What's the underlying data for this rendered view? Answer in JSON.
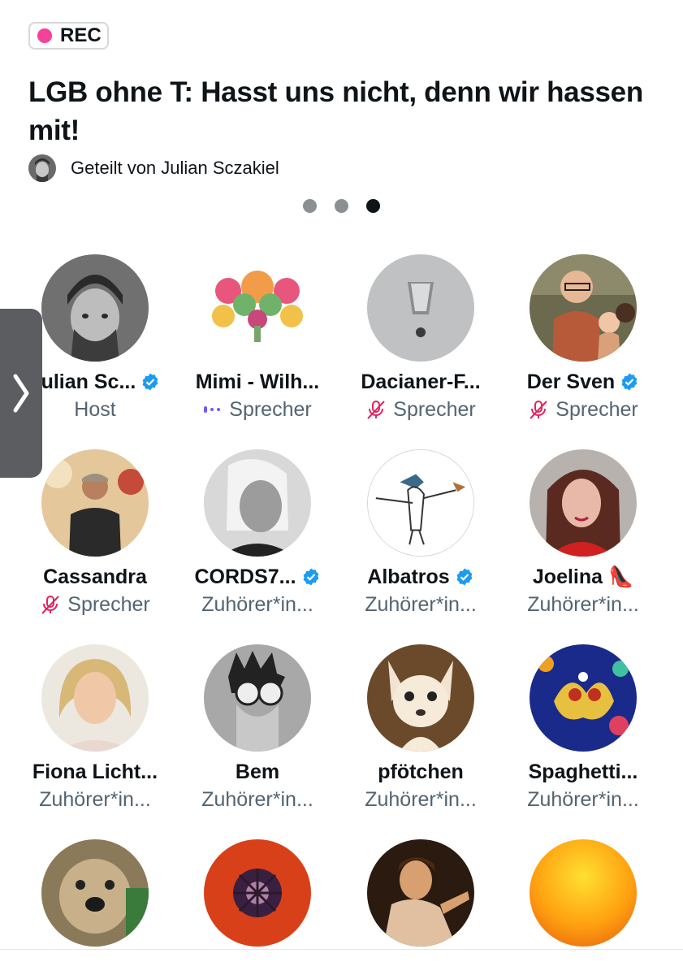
{
  "rec_label": "REC",
  "title": "LGB ohne T: Hasst uns nicht, denn wir hassen mit!",
  "shared_by": "Geteilt von Julian Sczakiel",
  "pager": {
    "count": 3,
    "active": 3
  },
  "colors": {
    "rec": "#f4419a",
    "verified": "#1d9bf0",
    "muted": "#e0245e",
    "speaking": "#7856ff",
    "secondary": "#536471"
  },
  "participants": [
    {
      "name": "Julian Sc...",
      "verified": true,
      "role": "Host",
      "role_icon": ""
    },
    {
      "name": "Mimi - Wilh...",
      "verified": false,
      "role": "Sprecher",
      "role_icon": "speaking-icon"
    },
    {
      "name": "Dacianer-F...",
      "verified": false,
      "role": "Sprecher",
      "role_icon": "mic-muted-icon"
    },
    {
      "name": "Der Sven",
      "verified": true,
      "role": "Sprecher",
      "role_icon": "mic-muted-icon"
    },
    {
      "name": "Cassandra",
      "verified": false,
      "role": "Sprecher",
      "role_icon": "mic-muted-icon"
    },
    {
      "name": "CORDS7...",
      "verified": true,
      "role": "Zuhörer*in...",
      "role_icon": ""
    },
    {
      "name": "Albatros",
      "verified": true,
      "role": "Zuhörer*in...",
      "role_icon": ""
    },
    {
      "name": "Joelina 👠",
      "verified": false,
      "role": "Zuhörer*in...",
      "role_icon": ""
    },
    {
      "name": "Fiona Licht...",
      "verified": false,
      "role": "Zuhörer*in...",
      "role_icon": ""
    },
    {
      "name": "Bem",
      "verified": false,
      "role": "Zuhörer*in...",
      "role_icon": ""
    },
    {
      "name": "pfötchen",
      "verified": false,
      "role": "Zuhörer*in...",
      "role_icon": ""
    },
    {
      "name": "Spaghetti...",
      "verified": false,
      "role": "Zuhörer*in...",
      "role_icon": ""
    },
    {
      "name": "",
      "verified": false,
      "role": "",
      "role_icon": ""
    },
    {
      "name": "",
      "verified": false,
      "role": "",
      "role_icon": ""
    },
    {
      "name": "",
      "verified": false,
      "role": "",
      "role_icon": ""
    },
    {
      "name": "",
      "verified": false,
      "role": "",
      "role_icon": ""
    }
  ]
}
